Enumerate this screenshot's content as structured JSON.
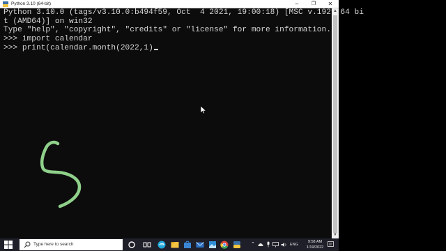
{
  "window": {
    "title": "Python 3.10 (64-bit)",
    "minimize_icon": "minimize-icon",
    "maximize_icon": "maximize-icon",
    "close_icon": "close-icon"
  },
  "console": {
    "lines": [
      "Python 3.10.0 (tags/v3.10.0:b494f59, Oct  4 2021, 19:00:18) [MSC v.1929 64 bi",
      "t (AMD64)] on win32",
      "Type \"help\", \"copyright\", \"credits\" or \"license\" for more information.",
      ">>> import calendar",
      ">>> print(calendar.month(2022,1)"
    ],
    "text_color": "#d6d6d6",
    "background": "#0c0c0c"
  },
  "annotation": {
    "ink_color": "#8fd08a",
    "shape": "handwritten-5"
  },
  "taskbar": {
    "search_placeholder": "Type here to search",
    "icons": [
      "windows-start-icon",
      "search-icon",
      "cortana-icon",
      "task-view-icon",
      "edge-icon",
      "file-explorer-icon",
      "store-icon",
      "mail-icon",
      "photos-icon",
      "chrome-icon",
      "python-icon"
    ],
    "tray": {
      "language": "ENG",
      "time": "9:58 AM",
      "date": "1/19/2022"
    }
  }
}
